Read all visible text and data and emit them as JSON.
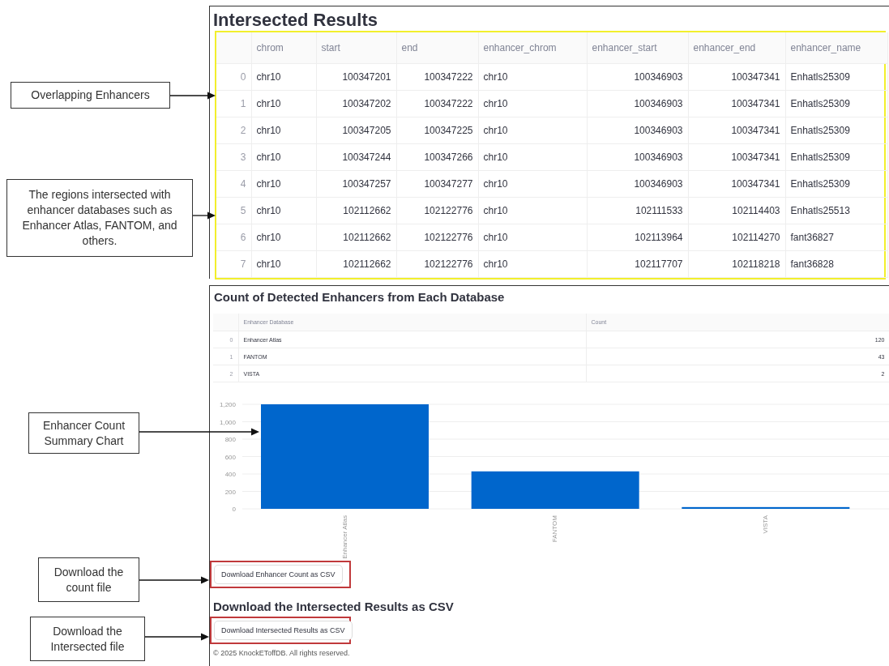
{
  "annotations": [
    {
      "text": "Overlapping Enhancers"
    },
    {
      "text": "The regions intersected with enhancer databases such as Enhancer Atlas, FANTOM, and others."
    },
    {
      "text": "Enhancer Count Summary Chart"
    },
    {
      "text": "Download the count file"
    },
    {
      "text": "Download the Intersected file"
    }
  ],
  "results": {
    "title": "Intersected Results",
    "columns": [
      {
        "label": "chrom",
        "kind": "text"
      },
      {
        "label": "start",
        "kind": "number"
      },
      {
        "label": "end",
        "kind": "number"
      },
      {
        "label": "enhancer_chrom",
        "kind": "text"
      },
      {
        "label": "enhancer_start",
        "kind": "number"
      },
      {
        "label": "enhancer_end",
        "kind": "number"
      },
      {
        "label": "enhancer_name",
        "kind": "text"
      }
    ],
    "rows": [
      {
        "index": "0",
        "cells": [
          "chr10",
          "100347201",
          "100347222",
          "chr10",
          "100346903",
          "100347341",
          "Enhatls25309"
        ]
      },
      {
        "index": "1",
        "cells": [
          "chr10",
          "100347202",
          "100347222",
          "chr10",
          "100346903",
          "100347341",
          "Enhatls25309"
        ]
      },
      {
        "index": "2",
        "cells": [
          "chr10",
          "100347205",
          "100347225",
          "chr10",
          "100346903",
          "100347341",
          "Enhatls25309"
        ]
      },
      {
        "index": "3",
        "cells": [
          "chr10",
          "100347244",
          "100347266",
          "chr10",
          "100346903",
          "100347341",
          "Enhatls25309"
        ]
      },
      {
        "index": "4",
        "cells": [
          "chr10",
          "100347257",
          "100347277",
          "chr10",
          "100346903",
          "100347341",
          "Enhatls25309"
        ]
      },
      {
        "index": "5",
        "cells": [
          "chr10",
          "102112662",
          "102122776",
          "chr10",
          "102111533",
          "102114403",
          "Enhatls25513"
        ]
      },
      {
        "index": "6",
        "cells": [
          "chr10",
          "102112662",
          "102122776",
          "chr10",
          "102113964",
          "102114270",
          "fant36827"
        ]
      },
      {
        "index": "7",
        "cells": [
          "chr10",
          "102112662",
          "102122776",
          "chr10",
          "102117707",
          "102118218",
          "fant36828"
        ]
      }
    ]
  },
  "summary": {
    "title": "Count of Detected Enhancers from Each Database",
    "table": {
      "columns": [
        {
          "label": "Enhancer Database",
          "kind": "text"
        },
        {
          "label": "Count",
          "kind": "number"
        }
      ],
      "rows": [
        {
          "index": "0",
          "cells": [
            "Enhancer Atlas",
            "120"
          ]
        },
        {
          "index": "1",
          "cells": [
            "FANTOM",
            "43"
          ]
        },
        {
          "index": "2",
          "cells": [
            "VISTA",
            "2"
          ]
        }
      ]
    },
    "chart_data": {
      "type": "bar",
      "categories": [
        "Enhancer Atlas",
        "FANTOM",
        "VISTA"
      ],
      "grid": true,
      "series": [
        {
          "color": "#0066cc",
          "values": [
            1200,
            430,
            20
          ]
        }
      ],
      "ylim": [
        0,
        1200
      ],
      "yticks": [
        {
          "value": 0,
          "label": "0"
        },
        {
          "value": 200,
          "label": "200"
        },
        {
          "value": 400,
          "label": "400"
        },
        {
          "value": 600,
          "label": "600"
        },
        {
          "value": 800,
          "label": "800"
        },
        {
          "value": 1000,
          "label": "1,000"
        },
        {
          "value": 1200,
          "label": "1,200"
        }
      ]
    }
  },
  "download_count_button": "Download Enhancer Count as CSV",
  "download_section": {
    "title": "Download the Intersected Results as CSV",
    "button": "Download Intersected Results as CSV"
  },
  "footer": "© 2025 KnockEToffDB. All rights reserved."
}
